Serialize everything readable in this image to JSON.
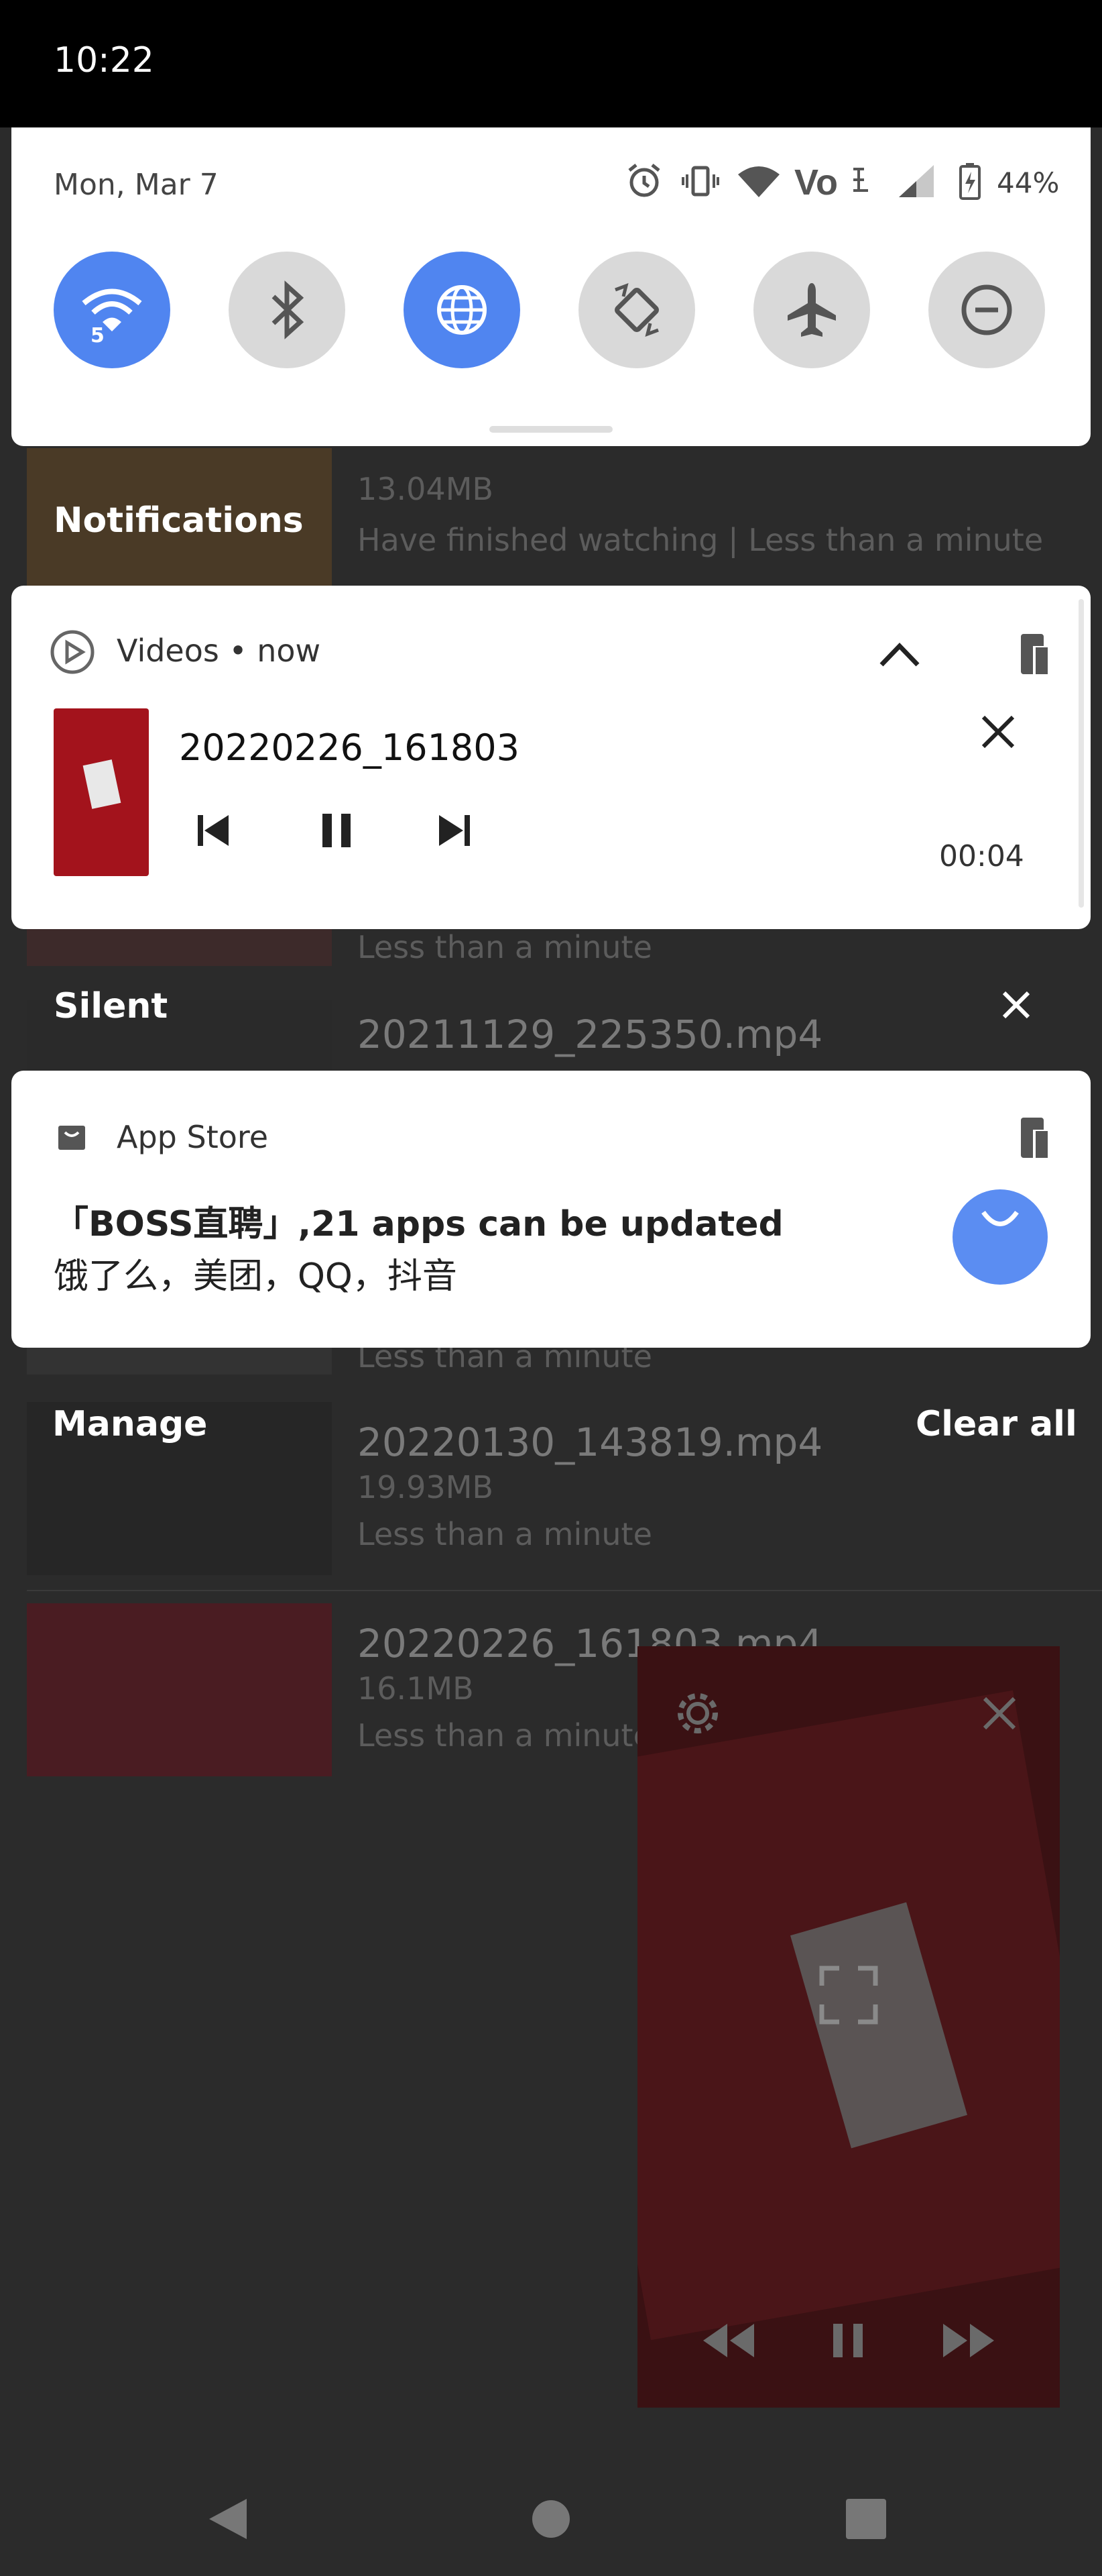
{
  "status_bar": {
    "time": "10:22"
  },
  "quick_settings": {
    "date": "Mon, Mar 7",
    "battery_percent": "44%",
    "status_icons": [
      "alarm-icon",
      "vibrate-icon",
      "wifi-icon",
      "volte-icon",
      "signal-icon",
      "battery-icon"
    ],
    "tiles": [
      {
        "name": "wifi",
        "icon": "wifi-icon",
        "active": true,
        "badge": "5"
      },
      {
        "name": "bluetooth",
        "icon": "bluetooth-icon",
        "active": false
      },
      {
        "name": "data",
        "icon": "globe-icon",
        "active": true
      },
      {
        "name": "auto-rotate",
        "icon": "rotate-icon",
        "active": false
      },
      {
        "name": "airplane",
        "icon": "airplane-icon",
        "active": false
      },
      {
        "name": "dnd",
        "icon": "dnd-icon",
        "active": false
      }
    ]
  },
  "sections": {
    "notifications": "Notifications",
    "silent": "Silent",
    "manage": "Manage",
    "clear_all": "Clear all"
  },
  "media_notification": {
    "app": "Videos",
    "time": "now",
    "title": "20220226_161803",
    "elapsed": "00:04"
  },
  "store_notification": {
    "app": "App Store",
    "line1": "「BOSS直聘」,21 apps can be updated",
    "line2": "饿了么，美团，QQ，抖音"
  },
  "background_list": [
    {
      "size": "13.04MB",
      "meta": "Have finished watching | Less than a minute"
    },
    {
      "meta": "Less than a minute"
    },
    {
      "title": "20211129_225350.mp4"
    },
    {
      "meta": "Less than a minute"
    },
    {
      "title": "20220130_143819.mp4",
      "size": "19.93MB",
      "meta": "Less than a minute"
    },
    {
      "title": "20220226_161803.mp4",
      "size": "16.1MB",
      "meta": "Less than a minute"
    }
  ],
  "colors": {
    "accent": "#5085f0",
    "tile_off": "#d9d9d9",
    "scrim": "#2b2b2b"
  }
}
